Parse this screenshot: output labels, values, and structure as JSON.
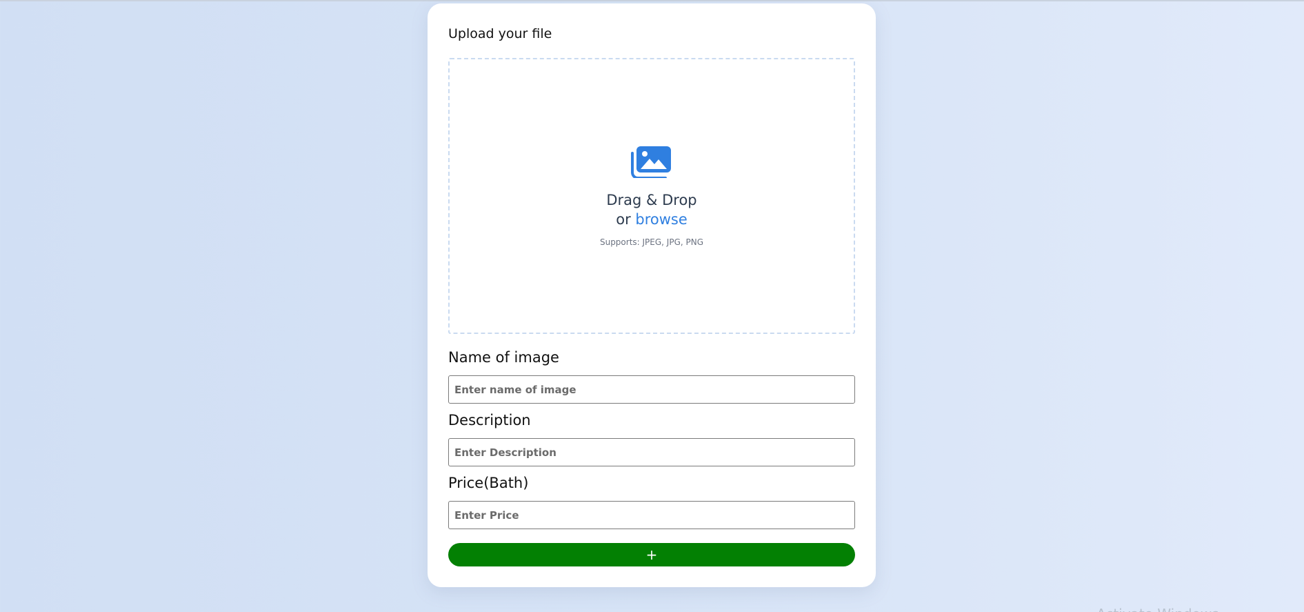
{
  "upload": {
    "title": "Upload your file",
    "drag_drop": "Drag & Drop",
    "or": "or",
    "browse": "browse",
    "supports": "Supports: JPEG, JPG, PNG",
    "icon": "photo-stack-icon",
    "accent_color": "#2f7fe0"
  },
  "form": {
    "name_label": "Name of image",
    "name_placeholder": "Enter name of image",
    "description_label": "Description",
    "description_placeholder": "Enter Description",
    "price_label": "Price(Bath)",
    "price_placeholder": "Enter Price",
    "add_label": "+",
    "add_color": "#038003"
  },
  "watermark": {
    "text": "Activate Windows"
  }
}
